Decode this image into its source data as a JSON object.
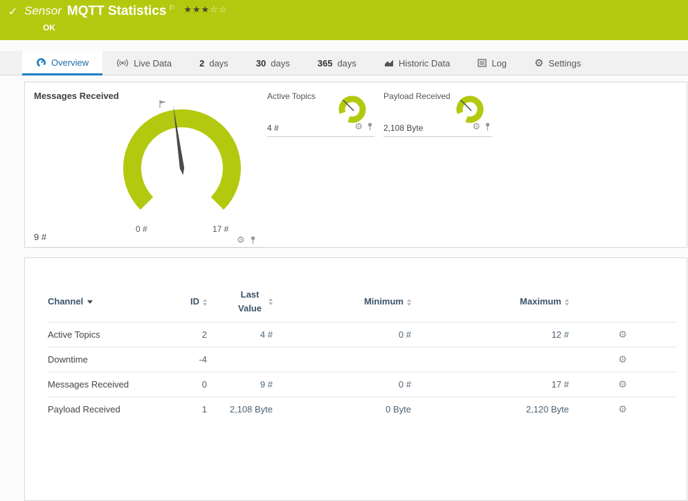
{
  "colors": {
    "brand_green": "#b3c90f",
    "accent_blue": "#1a7fbe"
  },
  "header": {
    "check_icon": "✓",
    "kind": "Sensor",
    "title": "MQTT Statistics",
    "flag_icon": "⚐",
    "stars_filled": "★★★",
    "stars_empty": "☆☆",
    "status": "OK"
  },
  "tabs": {
    "overview": "Overview",
    "live_data": "Live Data",
    "d2_num": "2",
    "d2_label": "days",
    "d30_num": "30",
    "d30_label": "days",
    "d365_num": "365",
    "d365_label": "days",
    "historic": "Historic Data",
    "log": "Log",
    "settings": "Settings",
    "settings_gear": "⚙"
  },
  "gauges": {
    "gear_icon": "⚙",
    "primary": {
      "title": "Messages Received",
      "value": "9 #",
      "scale_min": "0 #",
      "scale_max": "17 #"
    },
    "active_topics": {
      "title": "Active Topics",
      "value": "4 #"
    },
    "payload": {
      "title": "Payload Received",
      "value": "2,108 Byte"
    }
  },
  "table": {
    "gear_icon": "⚙",
    "headers": {
      "channel": "Channel",
      "id": "ID",
      "last_value": "Last Value",
      "minimum": "Minimum",
      "maximum": "Maximum"
    },
    "rows": [
      {
        "channel": "Active Topics",
        "id": "2",
        "last": "4 #",
        "min": "0 #",
        "max": "12 #"
      },
      {
        "channel": "Downtime",
        "id": "-4",
        "last": "",
        "min": "",
        "max": ""
      },
      {
        "channel": "Messages Received",
        "id": "0",
        "last": "9 #",
        "min": "0 #",
        "max": "17 #"
      },
      {
        "channel": "Payload Received",
        "id": "1",
        "last": "2,108 Byte",
        "min": "0 Byte",
        "max": "2,120 Byte"
      }
    ]
  }
}
